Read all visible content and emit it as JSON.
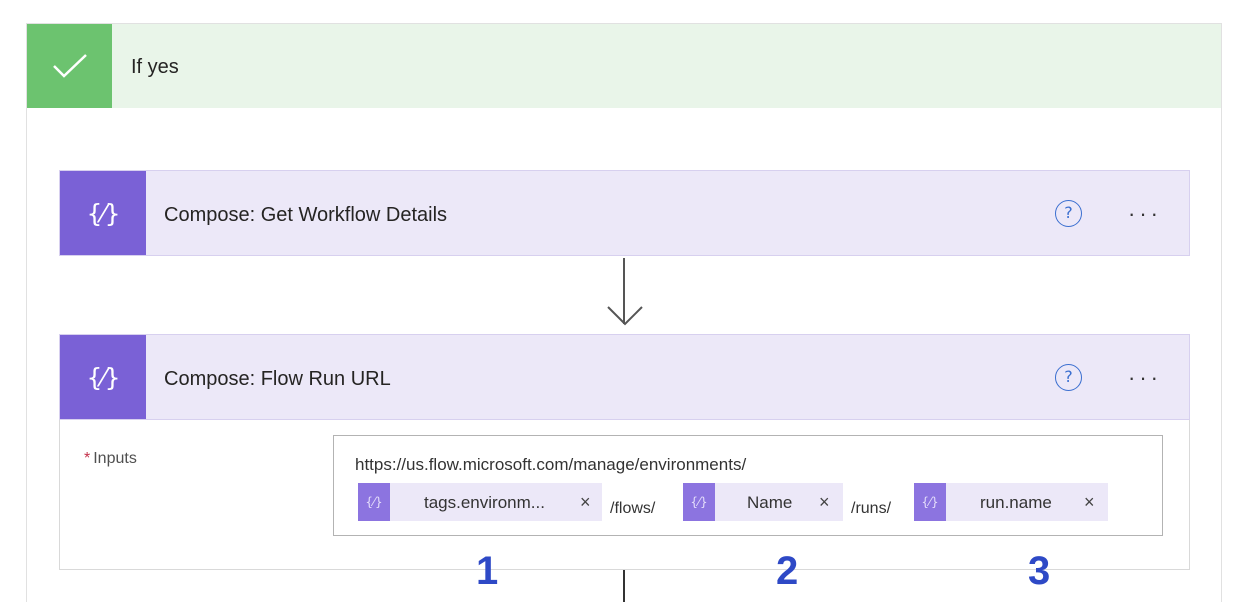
{
  "condition": {
    "title": "If yes",
    "icon": "checkmark-icon"
  },
  "actions": [
    {
      "icon": "compose-icon",
      "icon_glyph": "{⁄}",
      "title": "Compose: Get Workflow Details",
      "help_icon": "?",
      "more_icon": "···"
    },
    {
      "icon": "compose-icon",
      "icon_glyph": "{⁄}",
      "title": "Compose: Flow Run URL",
      "help_icon": "?",
      "more_icon": "···"
    }
  ],
  "inputs": {
    "required_marker": "*",
    "label": "Inputs",
    "text_prefix": "https://us.flow.microsoft.com/manage/environments/",
    "tokens": [
      {
        "label": "tags.environm...",
        "remove": "×",
        "icon_glyph": "{⁄}"
      },
      {
        "label": "Name",
        "remove": "×",
        "icon_glyph": "{⁄}"
      },
      {
        "label": "run.name",
        "remove": "×",
        "icon_glyph": "{⁄}"
      }
    ],
    "separators": [
      "/flows/",
      "/runs/"
    ]
  },
  "annotations": [
    "1",
    "2",
    "3"
  ],
  "colors": {
    "success": "#6cc36f",
    "success_bg": "#e9f5e9",
    "action": "#7a61d6",
    "action_bg": "#ece8f8",
    "annotation": "#2e49c6"
  }
}
